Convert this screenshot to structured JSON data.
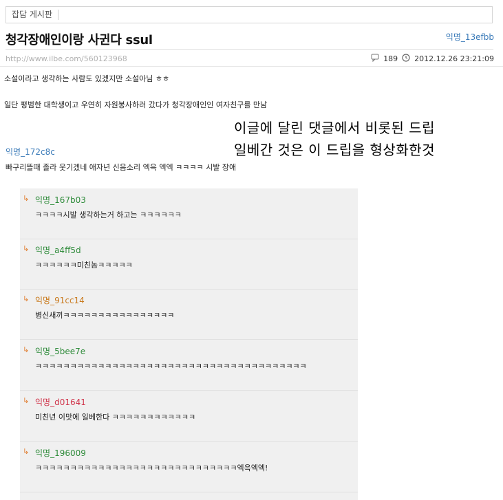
{
  "board": {
    "name": "잡담 게시판"
  },
  "post": {
    "title": "청각장애인이랑 사귄다 ssul",
    "author": "익명_13efbb",
    "url": "http://www.ilbe.com/560123968",
    "views": "189",
    "datetime": "2012.12.26 23:21:09",
    "body": [
      "소설이라고 생각하는 사람도 있겠지만 소설아님 ㅎㅎ",
      "일단 평범한 대학생이고 우연히 자원봉사하러 갔다가 청각장애인인 여자친구를 만남"
    ]
  },
  "overlay_text": {
    "line1": "이글에 달린 댓글에서 비롯된 드립",
    "line2": "일베간 것은 이 드립을 형상화한것"
  },
  "comment": {
    "author": "익명_172c8c",
    "text": "빠구리뜰때 졸라 웃기겠네 애자년 신음소리 엑윽 엑엑 ㅋㅋㅋㅋ 시발 장애"
  },
  "replies": [
    {
      "arrow": "↳",
      "author": "익명_167b03",
      "color": "#2e8b3a",
      "text": "ㅋㅋㅋㅋ시발 생각하는거 하고는 ㅋㅋㅋㅋㅋㅋ"
    },
    {
      "arrow": "↳",
      "author": "익명_a4ff5d",
      "color": "#2e8b3a",
      "text": "ㅋㅋㅋㅋㅋㅋ미친놈ㅋㅋㅋㅋㅋ"
    },
    {
      "arrow": "↳",
      "author": "익명_91cc14",
      "color": "#c97a1e",
      "text": "병신새끼ㅋㅋㅋㅋㅋㅋㅋㅋㅋㅋㅋㅋㅋㅋㅋㅋ"
    },
    {
      "arrow": "↳",
      "author": "익명_5bee7e",
      "color": "#2e8b3a",
      "text": "ㅋㅋㅋㅋㅋㅋㅋㅋㅋㅋㅋㅋㅋㅋㅋㅋㅋㅋㅋㅋㅋㅋㅋㅋㅋㅋㅋㅋㅋㅋㅋㅋㅋㅋㅋㅋㅋㅋㅋ"
    },
    {
      "arrow": "↳",
      "author": "익명_d01641",
      "color": "#d0344a",
      "text": "미친년 이맛에 일베한다 ㅋㅋㅋㅋㅋㅋㅋㅋㅋㅋㅋㅋ"
    },
    {
      "arrow": "↳",
      "author": "익명_196009",
      "color": "#2e8b3a",
      "text": "ㅋㅋㅋㅋㅋㅋㅋㅋㅋㅋㅋㅋㅋㅋㅋㅋㅋㅋㅋㅋㅋㅋㅋㅋㅋㅋㅋㅋㅋ엑윽엑엑!"
    }
  ]
}
